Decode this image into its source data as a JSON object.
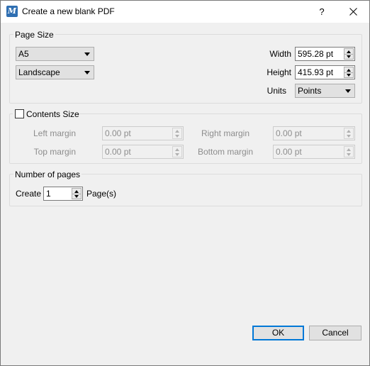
{
  "window": {
    "title": "Create a new blank PDF",
    "app_icon_letter": "M",
    "help_label": "?"
  },
  "page_size": {
    "group_title": "Page Size",
    "format": "A5",
    "orientation": "Landscape",
    "width_label": "Width",
    "width_value": "595.28 pt",
    "height_label": "Height",
    "height_value": "415.93 pt",
    "units_label": "Units",
    "units_value": "Points"
  },
  "contents_size": {
    "group_title": "Contents Size",
    "checked": false,
    "left_margin_label": "Left margin",
    "left_margin_value": "0.00 pt",
    "right_margin_label": "Right margin",
    "right_margin_value": "0.00 pt",
    "top_margin_label": "Top margin",
    "top_margin_value": "0.00 pt",
    "bottom_margin_label": "Bottom margin",
    "bottom_margin_value": "0.00 pt"
  },
  "pages": {
    "group_title": "Number of pages",
    "create_label": "Create",
    "count_value": "1",
    "suffix_label": "Page(s)"
  },
  "buttons": {
    "ok_label": "OK",
    "cancel_label": "Cancel"
  },
  "colors": {
    "accent": "#0078d7",
    "app_icon": "#2f6fb2",
    "disabled_text": "#8d8d8d"
  }
}
